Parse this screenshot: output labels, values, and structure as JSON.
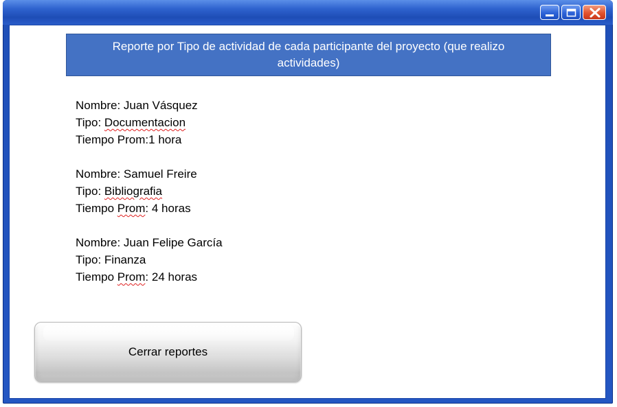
{
  "window": {
    "controls": {
      "minimize_icon": "minimize-icon",
      "maximize_icon": "maximize-icon",
      "close_icon": "close-icon"
    }
  },
  "report": {
    "title": "Reporte por Tipo de actividad de cada participante del proyecto (que realizo actividades)",
    "records": [
      {
        "nombre_label": "Nombre:",
        "nombre": "Juan Vásquez",
        "tipo_label": "Tipo:",
        "tipo": "Documentacion",
        "tiempo_label": "Tiempo",
        "prom_label": "Prom",
        "tiempo": ":1 hora"
      },
      {
        "nombre_label": "Nombre:",
        "nombre": "Samuel Freire",
        "tipo_label": "Tipo:",
        "tipo": "Bibliografia",
        "tiempo_label": "Tiempo",
        "prom_label": "Prom",
        "tiempo": ": 4 horas"
      },
      {
        "nombre_label": "Nombre:",
        "nombre": "Juan Felipe García",
        "tipo_label": "Tipo:",
        "tipo": "Finanza",
        "tiempo_label": "Tiempo",
        "prom_label": "Prom",
        "tiempo": ": 24 horas"
      }
    ]
  },
  "actions": {
    "close_reports_label": "Cerrar reportes"
  },
  "colors": {
    "header_bg": "#4472c4",
    "titlebar": "#2456c2",
    "close_control": "#e2532e"
  }
}
